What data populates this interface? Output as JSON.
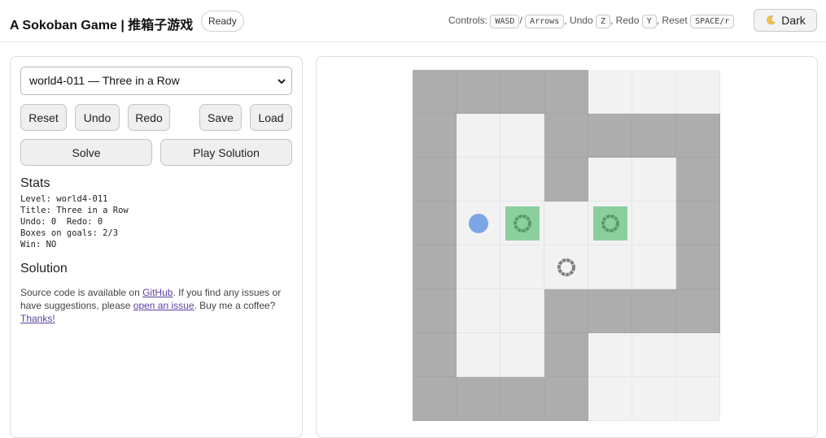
{
  "header": {
    "title": "A Sokoban Game | 推箱子游戏",
    "status": "Ready",
    "controls": {
      "label": "Controls:",
      "move_keys_1": "WASD",
      "separator": "/",
      "move_keys_2": "Arrows",
      "undo_label": ", Undo",
      "undo_key": "Z",
      "redo_label": ", Redo",
      "redo_key": "Y",
      "reset_label": ", Reset",
      "reset_key": "SPACE/r"
    },
    "theme_button_label": "Dark",
    "theme_icon": "moon-icon"
  },
  "sidebar": {
    "level_select_value": "world4-011 — Three in a Row",
    "buttons": {
      "reset": "Reset",
      "undo": "Undo",
      "redo": "Redo",
      "save": "Save",
      "load": "Load",
      "solve": "Solve",
      "play_solution": "Play Solution"
    },
    "stats_heading": "Stats",
    "stats": [
      "Level: world4-011",
      "Title: Three in a Row",
      "Undo: 0  Redo: 0",
      "Boxes on goals: 2/3",
      "Win: NO"
    ],
    "solution_heading": "Solution",
    "about": {
      "text_1": "Source code is available on ",
      "link_github": "GitHub",
      "text_2": ". If you find any issues or have suggestions, please ",
      "link_issue": "open an issue",
      "text_3": ". Buy me a coffee? ",
      "link_thanks": "Thanks!"
    }
  },
  "board": {
    "legend": {
      "W": "wall",
      "F": "floor",
      "O": "outside",
      "P": "player",
      "B": "box",
      "G": "goal",
      "*": "box-on-goal"
    },
    "rows": [
      "WWWWOOO",
      "WFFWWWW",
      "WFFWFFW",
      "WP*F*FW",
      "WFFGFFW",
      "WFFWWWW",
      "WFFWOOO",
      "WWWWOOO"
    ]
  },
  "colors": {
    "wall": "#adadad",
    "floor": "#f2f2f2",
    "player": "#7aa6e6",
    "box": "#e6c48a",
    "box_on_goal": "#8ccf9e",
    "goal_ring": "#808080",
    "goal_ring_on_box": "#5a9a6a",
    "link": "#5a3fa0"
  }
}
